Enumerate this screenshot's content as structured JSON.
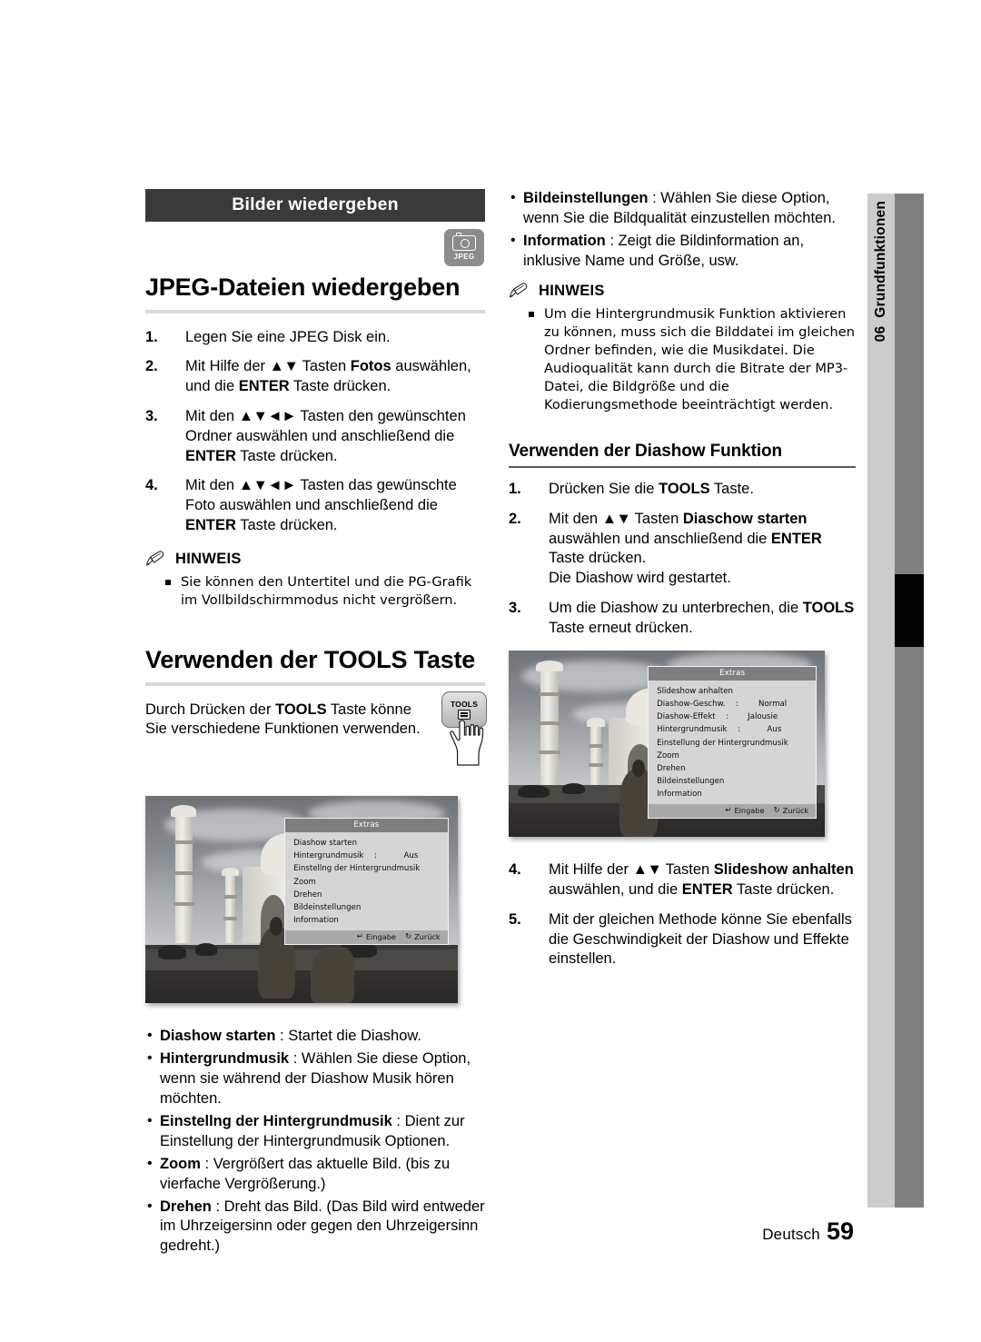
{
  "page": {
    "footer_language": "Deutsch",
    "footer_page_number": "59",
    "chapter_number": "06",
    "chapter_title": "Grundfunktionen"
  },
  "section": {
    "title_bar": "Bilder wiedergeben",
    "media_badge": "JPEG",
    "heading_main": "JPEG-Dateien wiedergeben",
    "steps": [
      {
        "num": "1.",
        "parts": [
          {
            "t": "Legen Sie eine JPEG Disk ein."
          }
        ]
      },
      {
        "num": "2.",
        "parts": [
          {
            "t": "Mit Hilfe der "
          },
          {
            "t": "▲▼",
            "arrows": true
          },
          {
            "t": " Tasten "
          },
          {
            "t": "Fotos",
            "b": true
          },
          {
            "t": " auswählen, und die "
          },
          {
            "t": "ENTER",
            "b": true
          },
          {
            "t": " Taste drücken."
          }
        ]
      },
      {
        "num": "3.",
        "parts": [
          {
            "t": "Mit den "
          },
          {
            "t": "▲▼◄►",
            "arrows": true
          },
          {
            "t": " Tasten den gewünschten Ordner auswählen und anschließend die "
          },
          {
            "t": "ENTER",
            "b": true
          },
          {
            "t": " Taste drücken."
          }
        ]
      },
      {
        "num": "4.",
        "parts": [
          {
            "t": "Mit den "
          },
          {
            "t": "▲▼◄►",
            "arrows": true
          },
          {
            "t": " Tasten das gewünschte Foto auswählen und anschließend die "
          },
          {
            "t": "ENTER",
            "b": true
          },
          {
            "t": " Taste drücken."
          }
        ]
      }
    ],
    "note": {
      "title": "HINWEIS",
      "items": [
        "Sie können den Untertitel und die PG-Grafik im Vollbildschirmmodus nicht vergrößern."
      ]
    }
  },
  "tools_section": {
    "heading_main": "Verwenden der TOOLS Taste",
    "intro_parts": [
      {
        "t": "Durch Drücken der "
      },
      {
        "t": "TOOLS",
        "b": true
      },
      {
        "t": " Taste könne Sie verschiedene Funktionen verwenden."
      }
    ],
    "key_label": "TOOLS",
    "bullets": [
      {
        "term": "Diashow starten",
        "sep": " : ",
        "desc": "Startet die Diashow."
      },
      {
        "term": "Hintergrundmusik",
        "sep": " : ",
        "desc": "Wählen Sie diese Option, wenn sie während der Diashow Musik hören möchten."
      },
      {
        "term": "Einstellng der Hintergrundmusik",
        "sep": " : ",
        "desc": "Dient zur Einstellung der Hintergrundmusik Optionen."
      },
      {
        "term": "Zoom",
        "sep": " : ",
        "desc": "Vergrößert das aktuelle Bild. (bis zu vierfache Vergrößerung.)"
      },
      {
        "term": "Drehen",
        "sep": " : ",
        "desc": "Dreht das Bild. (Das Bild wird entweder im Uhrzeigersinn oder gegen den Uhrzeigersinn gedreht.)"
      }
    ]
  },
  "right_column": {
    "bullets": [
      {
        "term": "Bildeinstellungen",
        "sep": " : ",
        "desc": "Wählen Sie diese Option, wenn Sie die Bildqualität einzustellen möchten."
      },
      {
        "term": "Information",
        "sep": " : ",
        "desc": "Zeigt die Bildinformation an, inklusive Name und Größe, usw."
      }
    ],
    "note": {
      "title": "HINWEIS",
      "items": [
        "Um die Hintergrundmusik Funktion aktivieren zu können, muss sich die Bilddatei im gleichen Ordner befinden, wie die Musikdatei. Die Audioqualität kann durch die Bitrate der MP3-Datei, die Bildgröße und die Kodierungsmethode beeinträchtigt werden."
      ]
    },
    "heading_sub": "Verwenden der Diashow Funktion",
    "steps": [
      {
        "num": "1.",
        "parts": [
          {
            "t": "Drücken Sie die "
          },
          {
            "t": "TOOLS",
            "b": true
          },
          {
            "t": " Taste."
          }
        ]
      },
      {
        "num": "2.",
        "parts": [
          {
            "t": "Mit den "
          },
          {
            "t": "▲▼",
            "arrows": true
          },
          {
            "t": " Tasten "
          },
          {
            "t": "Diaschow starten",
            "b": true
          },
          {
            "t": " auswählen und anschließend die "
          },
          {
            "t": "ENTER",
            "b": true
          },
          {
            "t": " Taste drücken.\nDie Diashow wird gestartet."
          }
        ]
      },
      {
        "num": "3.",
        "parts": [
          {
            "t": "Um die Diashow zu unterbrechen, die "
          },
          {
            "t": "TOOLS",
            "b": true
          },
          {
            "t": " Taste erneut drücken."
          }
        ]
      }
    ],
    "steps_after": [
      {
        "num": "4.",
        "parts": [
          {
            "t": "Mit Hilfe der "
          },
          {
            "t": "▲▼",
            "arrows": true
          },
          {
            "t": " Tasten "
          },
          {
            "t": "Slideshow anhalten",
            "b": true
          },
          {
            "t": " auswählen, und die "
          },
          {
            "t": "ENTER",
            "b": true
          },
          {
            "t": " Taste drücken."
          }
        ]
      },
      {
        "num": "5.",
        "parts": [
          {
            "t": "Mit der gleichen Methode könne Sie ebenfalls die Geschwindigkeit der Diashow und Effekte einstellen."
          }
        ]
      }
    ]
  },
  "osd_menu_1": {
    "title": "Extras",
    "rows": [
      {
        "label": "Diashow starten"
      },
      {
        "label": "Hintergrundmusik",
        "colon": ":",
        "value": "Aus"
      },
      {
        "label": "Einstellng der Hintergrundmusik"
      },
      {
        "label": "Zoom"
      },
      {
        "label": "Drehen"
      },
      {
        "label": "Bildeinstellungen"
      },
      {
        "label": "Information"
      }
    ],
    "footer_enter": "Eingabe",
    "footer_return": "Zurück"
  },
  "osd_menu_2": {
    "title": "Extras",
    "rows": [
      {
        "label": "Slideshow anhalten"
      },
      {
        "label": "Diashow-Geschw.",
        "colon": ":",
        "value": "Normal"
      },
      {
        "label": "Diashow-Effekt",
        "colon": ":",
        "value": "Jalousie"
      },
      {
        "label": "Hintergrundmusik",
        "colon": ":",
        "value": "Aus"
      },
      {
        "label": "Einstellung der Hintergrundmusik"
      },
      {
        "label": "Zoom"
      },
      {
        "label": "Drehen"
      },
      {
        "label": "Bildeinstellungen"
      },
      {
        "label": "Information"
      }
    ],
    "footer_enter": "Eingabe",
    "footer_return": "Zurück"
  },
  "icons": {
    "note": "pencil-icon",
    "enter": "enter-arrow-icon",
    "return": "return-arrow-icon",
    "badge": "camera-icon"
  },
  "colors": {
    "title_bar_bg": "#3a3a3a",
    "sidebar_light": "#cccccc",
    "sidebar_dark": "#808080",
    "rule_thick": "#d9d9d9",
    "badge_bg": "#8c8c8c"
  }
}
